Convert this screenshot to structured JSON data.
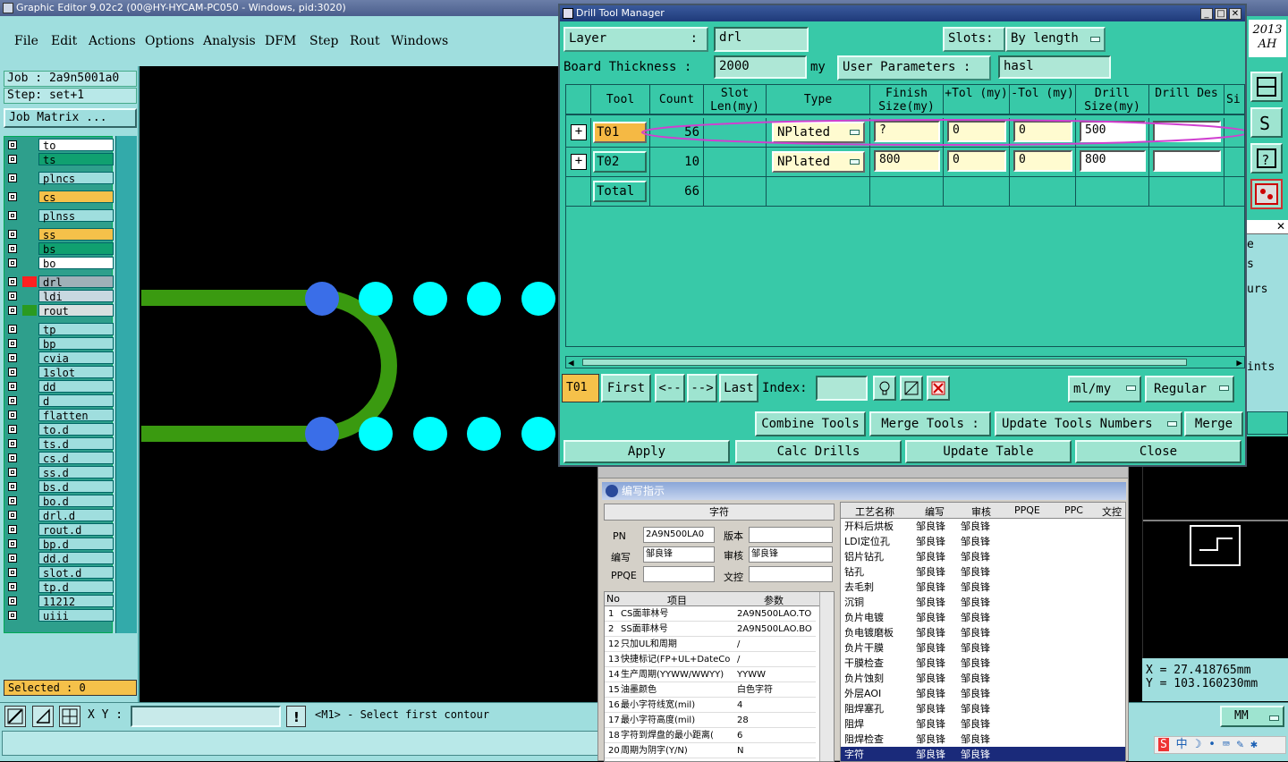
{
  "main_window": {
    "title": "Graphic Editor 9.02c2 (00@HY-HYCAM-PC050 - Windows, pid:3020)",
    "menu": [
      "File",
      "Edit",
      "Actions",
      "Options",
      "Analysis",
      "DFM",
      "Step",
      "Rout",
      "Windows"
    ],
    "year_badge_line1": "2013",
    "year_badge_line2": "AH"
  },
  "left_panel": {
    "job": "Job : 2a9n5001a0",
    "step": "Step: set+1",
    "job_matrix_button": "Job Matrix ...",
    "layers": [
      {
        "name": "to",
        "color": "#ffffff",
        "swatch": ""
      },
      {
        "name": "ts",
        "color": "#10a070",
        "swatch": ""
      },
      {
        "name": "plncs",
        "color": "#9fdede",
        "swatch": ""
      },
      {
        "name": "cs",
        "color": "#f5c14a",
        "swatch": ""
      },
      {
        "name": "plnss",
        "color": "#9fdede",
        "swatch": ""
      },
      {
        "name": "ss",
        "color": "#f5c14a",
        "swatch": ""
      },
      {
        "name": "bs",
        "color": "#10a070",
        "swatch": ""
      },
      {
        "name": "bo",
        "color": "#ffffff",
        "swatch": ""
      },
      {
        "name": "drl",
        "color": "#9fb0b8",
        "swatch": "#ff2020"
      },
      {
        "name": "ldi",
        "color": "#c8d8e0",
        "swatch": ""
      },
      {
        "name": "rout",
        "color": "#d8e0e0",
        "swatch": "#2a9a20"
      },
      {
        "name": "tp",
        "color": "#9fdede",
        "swatch": ""
      },
      {
        "name": "bp",
        "color": "#9fdede",
        "swatch": ""
      },
      {
        "name": "cvia",
        "color": "#9fdede",
        "swatch": ""
      },
      {
        "name": "1slot",
        "color": "#9fdede",
        "swatch": ""
      },
      {
        "name": "dd",
        "color": "#9fdede",
        "swatch": ""
      },
      {
        "name": "d",
        "color": "#9fdede",
        "swatch": ""
      },
      {
        "name": "flatten",
        "color": "#9fdede",
        "swatch": ""
      },
      {
        "name": "to.d",
        "color": "#9fdede",
        "swatch": ""
      },
      {
        "name": "ts.d",
        "color": "#9fdede",
        "swatch": ""
      },
      {
        "name": "cs.d",
        "color": "#9fdede",
        "swatch": ""
      },
      {
        "name": "ss.d",
        "color": "#9fdede",
        "swatch": ""
      },
      {
        "name": "bs.d",
        "color": "#9fdede",
        "swatch": ""
      },
      {
        "name": "bo.d",
        "color": "#9fdede",
        "swatch": ""
      },
      {
        "name": "drl.d",
        "color": "#9fdede",
        "swatch": ""
      },
      {
        "name": "rout.d",
        "color": "#9fdede",
        "swatch": ""
      },
      {
        "name": "bp.d",
        "color": "#9fdede",
        "swatch": ""
      },
      {
        "name": "dd.d",
        "color": "#9fdede",
        "swatch": ""
      },
      {
        "name": "slot.d",
        "color": "#9fdede",
        "swatch": ""
      },
      {
        "name": "tp.d",
        "color": "#9fdede",
        "swatch": ""
      },
      {
        "name": "11212",
        "color": "#9fdede",
        "swatch": ""
      },
      {
        "name": "uiii",
        "color": "#9fdede",
        "swatch": ""
      }
    ],
    "selected": "Selected : 0"
  },
  "bottom": {
    "xy_label": "X Y :",
    "xy_value": "",
    "message": "<M1> - Select first contour",
    "units": "MM",
    "coord_x": "X  =  27.418765mm",
    "coord_y": "Y  =  103.160230mm"
  },
  "drill_tool_manager": {
    "title": "Drill Tool Manager",
    "layer_label": "Layer",
    "layer_value": "drl",
    "slots_label": "Slots:",
    "slots_value": "By length",
    "board_thickness_label": "Board Thickness :",
    "board_thickness_value": "2000",
    "board_thickness_unit": "my",
    "user_params_button": "User Parameters :",
    "user_params_value": "hasl",
    "columns": [
      "Tool",
      "Count",
      "Slot Len(my)",
      "Type",
      "Finish Size(my)",
      "+Tol (my)",
      "-Tol (my)",
      "Drill Size(my)",
      "Drill Des",
      "Si"
    ],
    "rows": [
      {
        "tool": "T01",
        "count": "56",
        "type": "NPlated",
        "finish": "?",
        "ptol": "0",
        "mtol": "0",
        "drill": "500",
        "des": ""
      },
      {
        "tool": "T02",
        "count": "10",
        "type": "NPlated",
        "finish": "800",
        "ptol": "0",
        "mtol": "0",
        "drill": "800",
        "des": ""
      }
    ],
    "total_label": "Total",
    "total_count": "66",
    "nav": {
      "current": "T01",
      "first": "First",
      "prev": "<--",
      "next": "-->",
      "last": "Last",
      "index_label": "Index:",
      "index_value": "",
      "units": "ml/my",
      "mode": "Regular"
    },
    "actions": {
      "combine": "Combine Tools",
      "merge_tools": "Merge Tools :",
      "update_numbers": "Update Tools Numbers",
      "merge": "Merge"
    },
    "footer": {
      "apply": "Apply",
      "calc": "Calc Drills",
      "update_table": "Update Table",
      "close": "Close"
    }
  },
  "behind_panel": {
    "labels": [
      "e",
      "s",
      "urs",
      "ints"
    ]
  },
  "cn_window": {
    "header": "编写指示",
    "section": "字符",
    "pn_label": "PN",
    "pn_value": "2A9N500LA0",
    "version_label": "版本",
    "author_label": "编写",
    "author_value": "邹良锋",
    "review_label": "审核",
    "review_value": "邹良锋",
    "ppqe_label": "PPQE",
    "doc_label": "文控",
    "left_cols": [
      "No",
      "项目",
      "参数"
    ],
    "left_rows": [
      {
        "no": "1",
        "item": "CS面菲林号",
        "val": "2A9N500LAO.TO"
      },
      {
        "no": "2",
        "item": "SS面菲林号",
        "val": "2A9N500LAO.BO"
      },
      {
        "no": "12",
        "item": "只加UL和周期",
        "val": "/"
      },
      {
        "no": "13",
        "item": "快捷标记(FP+UL+DateCo",
        "val": "/"
      },
      {
        "no": "14",
        "item": "生产周期(YYWW/WWYY)",
        "val": "YYWW"
      },
      {
        "no": "15",
        "item": "油墨颜色",
        "val": "白色字符"
      },
      {
        "no": "16",
        "item": "最小字符线宽(mil)",
        "val": "4"
      },
      {
        "no": "17",
        "item": "最小字符高度(mil)",
        "val": "28"
      },
      {
        "no": "18",
        "item": "字符到焊盘的最小距离(",
        "val": "6"
      },
      {
        "no": "20",
        "item": "周期为阴字(Y/N)",
        "val": "N"
      }
    ],
    "right_cols": [
      "工艺名称",
      "编写",
      "审核",
      "PPQE",
      "PPC",
      "文控"
    ],
    "right_rows": [
      {
        "name": "开料后烘板",
        "a": "邹良锋",
        "b": "邹良锋"
      },
      {
        "name": "LDI定位孔",
        "a": "邹良锋",
        "b": "邹良锋"
      },
      {
        "name": "铝片钻孔",
        "a": "邹良锋",
        "b": "邹良锋"
      },
      {
        "name": "钻孔",
        "a": "邹良锋",
        "b": "邹良锋"
      },
      {
        "name": "去毛刺",
        "a": "邹良锋",
        "b": "邹良锋"
      },
      {
        "name": "沉铜",
        "a": "邹良锋",
        "b": "邹良锋"
      },
      {
        "name": "负片电镀",
        "a": "邹良锋",
        "b": "邹良锋"
      },
      {
        "name": "负电镀磨板",
        "a": "邹良锋",
        "b": "邹良锋"
      },
      {
        "name": "负片干膜",
        "a": "邹良锋",
        "b": "邹良锋"
      },
      {
        "name": "干膜检查",
        "a": "邹良锋",
        "b": "邹良锋"
      },
      {
        "name": "负片蚀刻",
        "a": "邹良锋",
        "b": "邹良锋"
      },
      {
        "name": "外层AOI",
        "a": "邹良锋",
        "b": "邹良锋"
      },
      {
        "name": "阻焊塞孔",
        "a": "邹良锋",
        "b": "邹良锋"
      },
      {
        "name": "阻焊",
        "a": "邹良锋",
        "b": "邹良锋"
      },
      {
        "name": "阻焊检查",
        "a": "邹良锋",
        "b": "邹良锋"
      },
      {
        "name": "字符",
        "a": "邹良锋",
        "b": "邹良锋"
      }
    ]
  },
  "tray": {
    "ime_lang": "中"
  }
}
